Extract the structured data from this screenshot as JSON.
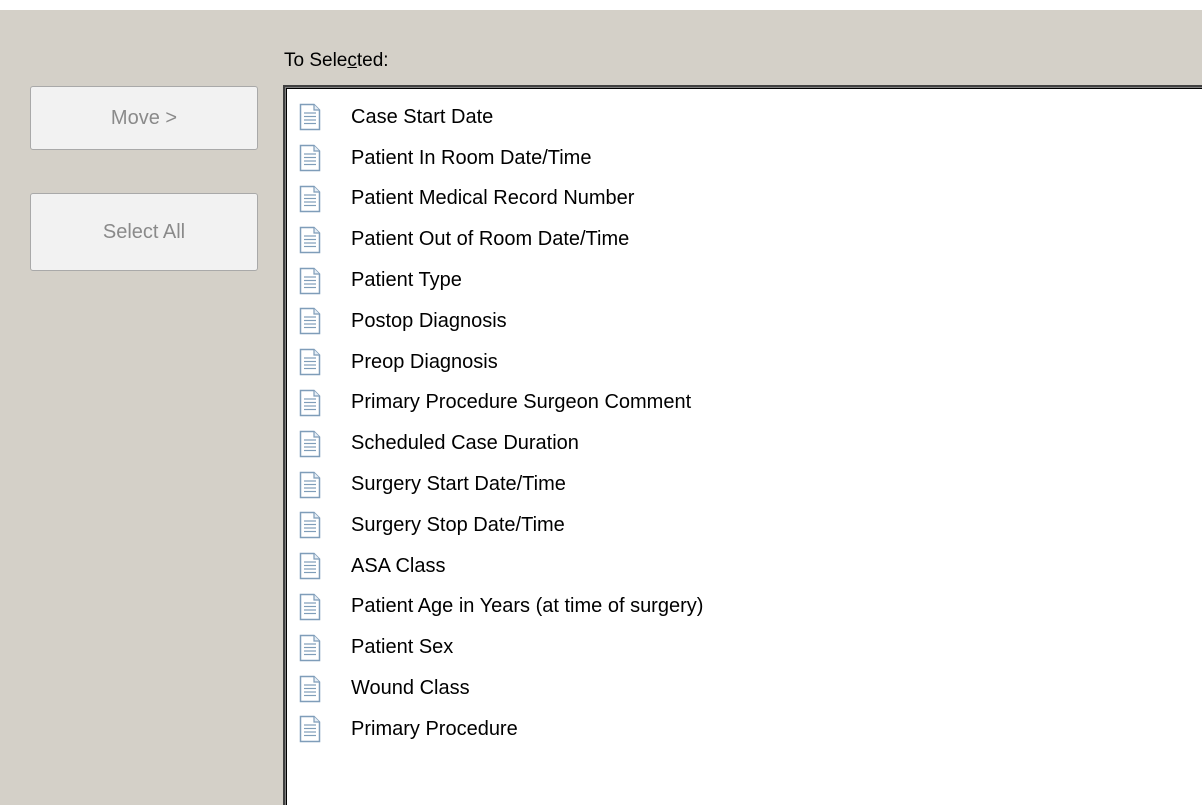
{
  "panel": {
    "label_prefix": "To Sele",
    "label_mnemonic": "c",
    "label_suffix": "ted:",
    "move_button": "Move >",
    "select_all_button": "Select All"
  },
  "list": {
    "icon": "document-icon",
    "items": [
      "Case Start Date",
      "Patient In Room Date/Time",
      "Patient Medical Record Number",
      "Patient Out of Room Date/Time",
      "Patient Type",
      "Postop Diagnosis",
      "Preop Diagnosis",
      "Primary Procedure Surgeon Comment",
      "Scheduled Case Duration",
      "Surgery Start Date/Time",
      "Surgery Stop Date/Time",
      "ASA Class",
      "Patient Age in Years (at time of surgery)",
      "Patient Sex",
      "Wound Class",
      "Primary Procedure"
    ]
  },
  "colors": {
    "background": "#d4d0c8",
    "disabled_text": "#8a8a8a",
    "icon_blue": "#7f9db9"
  }
}
